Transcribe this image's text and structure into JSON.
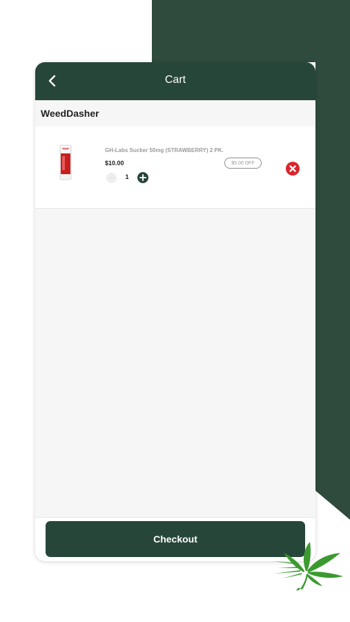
{
  "colors": {
    "brand_dark_green": "#27463a",
    "background_shape": "#2e4b3e",
    "remove_red": "#d9262c",
    "logo_green": "#3b9a2f"
  },
  "header": {
    "title": "Cart",
    "back_icon": "chevron-left-icon"
  },
  "store": {
    "name": "WeedDasher"
  },
  "cart_items": [
    {
      "name": "GH-Labs Sucker 50mg (STRAWBERRY) 2 PK.",
      "price": "$10.00",
      "discount": "$5.00 OFF",
      "quantity": "1",
      "minus_icon": "minus-circle-icon",
      "plus_icon": "plus-circle-icon",
      "remove_icon": "close-circle-icon"
    }
  ],
  "footer": {
    "checkout_label": "Checkout"
  },
  "logo_icon": "cannabis-leaf-logo"
}
